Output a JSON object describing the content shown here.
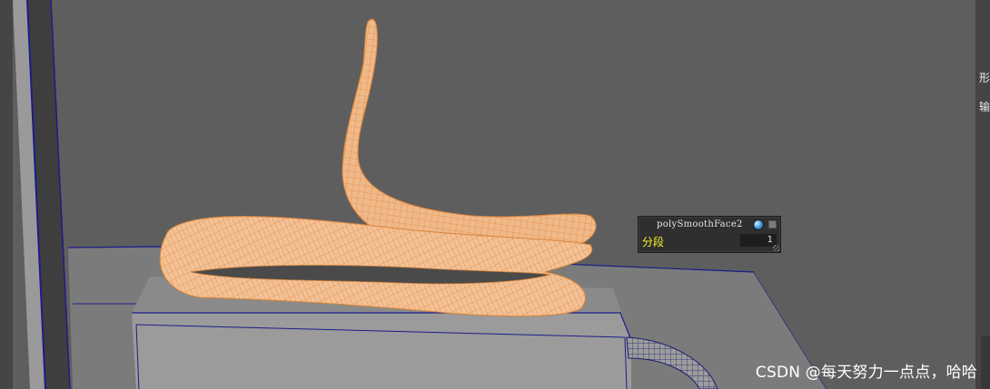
{
  "hud": {
    "node_name": "polySmoothFace2",
    "attribute_label": "分段",
    "attribute_value": "1"
  },
  "side_panel": {
    "tab_1": "形",
    "tab_2": "输"
  },
  "watermark": "CSDN @每天努力一点点，哈哈",
  "colors": {
    "viewport_bg": "#5e5e5e",
    "mesh_fill": "#f1bb8d",
    "mesh_wire": "#e99a50",
    "edge_blue": "#1c1c8a",
    "label_yellow": "#f5f52a"
  }
}
